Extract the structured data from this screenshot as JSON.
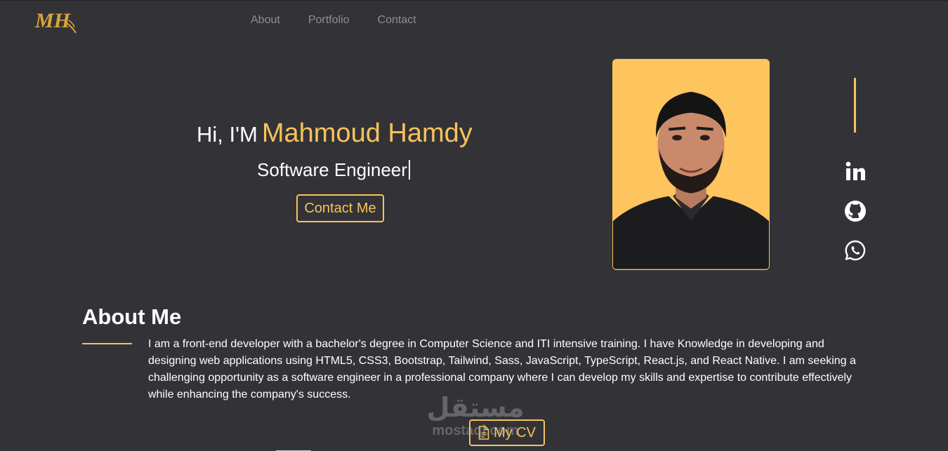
{
  "header": {
    "logo_text": "MH",
    "nav": [
      {
        "label": "About"
      },
      {
        "label": "Portfolio"
      },
      {
        "label": "Contact"
      }
    ]
  },
  "hero": {
    "greeting": "Hi, I'M",
    "name": "Mahmoud Hamdy",
    "role": "Software Engineer",
    "contact_label": "Contact Me"
  },
  "social": [
    {
      "icon": "linkedin-icon"
    },
    {
      "icon": "github-icon"
    },
    {
      "icon": "whatsapp-icon"
    }
  ],
  "about": {
    "title": "About Me",
    "body": "I am a front-end developer with a bachelor's degree in Computer Science and ITI intensive training. I have Knowledge in developing and designing web applications using HTML5, CSS3, Bootstrap, Tailwind, Sass, JavaScript, TypeScript, React.js, and React Native. I am seeking a challenging opportunity as a software engineer in a professional company where I can develop my skills and expertise to contribute effectively while enhancing the company's success.",
    "cv_label": "My CV"
  },
  "watermark": {
    "arabic": "مستقل",
    "latin": "mostaql.com"
  },
  "colors": {
    "background": "#333337",
    "accent": "#f7c25c",
    "nav_text": "#8f8f92",
    "portrait_bg": "#fec45d"
  }
}
